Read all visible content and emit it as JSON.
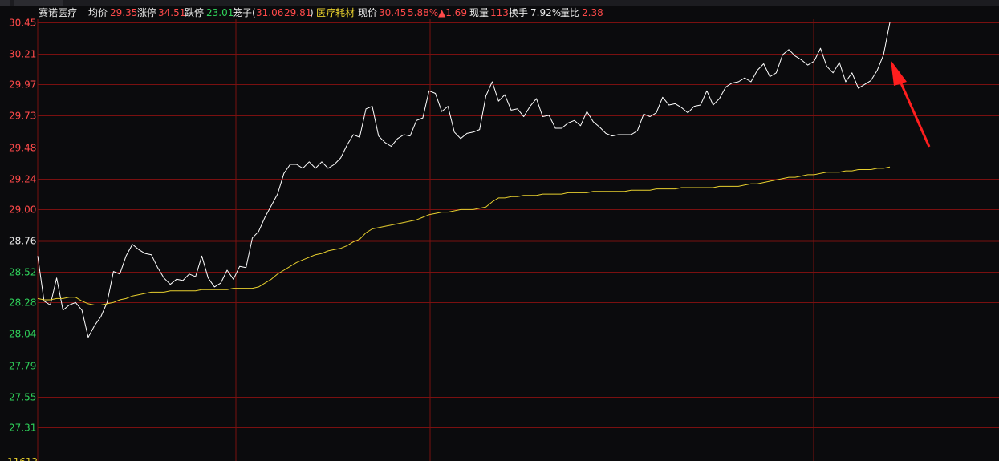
{
  "header": {
    "stock_name": "赛诺医疗",
    "avg_label": "均价",
    "avg_value": "29.35",
    "limit_up_label": "涨停",
    "limit_up_value": "34.51",
    "limit_down_label": "跌停",
    "limit_down_value": "23.01",
    "cage_label": "笼子(",
    "cage_value_1": "31.06",
    "cage_value_2": "29.81",
    "cage_close": ")",
    "sector": "医疗耗材",
    "price_label": "现价",
    "price_value": "30.45",
    "pct_change": "5.88%",
    "change": "▲1.69",
    "volume_label": "现量",
    "volume_value": "113",
    "turnover_label": "换手",
    "turnover_value": "7.92%",
    "vol_ratio_label": "量比",
    "vol_ratio_value": "2.38"
  },
  "colors": {
    "up": "#ff4a4a",
    "down": "#2fd15a",
    "grid": "#7a1010",
    "price_line": "#ffffff",
    "avg_line": "#e7cf2e",
    "arrow": "#ff1e1e",
    "background": "#0b0b0d"
  },
  "chart_data": {
    "type": "line",
    "title": "",
    "xlabel": "",
    "ylabel": "",
    "ylim": [
      27.07,
      30.45
    ],
    "prev_close": 28.76,
    "grid": true,
    "y_ticks": [
      "30.45",
      "30.21",
      "29.97",
      "29.73",
      "29.48",
      "29.24",
      "29.00",
      "28.76",
      "28.52",
      "28.28",
      "28.04",
      "27.79",
      "27.55",
      "27.31"
    ],
    "y_tick_partial": "11612",
    "series": [
      {
        "key": "price",
        "color": "#ffffff",
        "values": [
          28.64,
          28.29,
          28.26,
          28.47,
          28.22,
          28.26,
          28.28,
          28.22,
          28.01,
          28.1,
          28.17,
          28.28,
          28.52,
          28.5,
          28.64,
          28.73,
          28.69,
          28.66,
          28.65,
          28.55,
          28.47,
          28.42,
          28.46,
          28.45,
          28.5,
          28.48,
          28.64,
          28.47,
          28.4,
          28.43,
          28.53,
          28.46,
          28.56,
          28.55,
          28.78,
          28.83,
          28.94,
          29.03,
          29.12,
          29.28,
          29.35,
          29.35,
          29.32,
          29.37,
          29.32,
          29.37,
          29.32,
          29.35,
          29.4,
          29.5,
          29.58,
          29.56,
          29.78,
          29.8,
          29.57,
          29.52,
          29.49,
          29.55,
          29.58,
          29.57,
          29.69,
          29.71,
          29.92,
          29.9,
          29.76,
          29.8,
          29.6,
          29.55,
          29.59,
          29.6,
          29.62,
          29.88,
          29.99,
          29.84,
          29.89,
          29.77,
          29.78,
          29.72,
          29.8,
          29.86,
          29.72,
          29.73,
          29.63,
          29.63,
          29.67,
          29.69,
          29.65,
          29.76,
          29.68,
          29.64,
          29.59,
          29.57,
          29.58,
          29.58,
          29.58,
          29.61,
          29.74,
          29.72,
          29.75,
          29.87,
          29.81,
          29.82,
          29.79,
          29.75,
          29.8,
          29.81,
          29.92,
          29.81,
          29.86,
          29.95,
          29.98,
          29.99,
          30.02,
          29.99,
          30.08,
          30.13,
          30.03,
          30.06,
          30.2,
          30.24,
          30.19,
          30.16,
          30.12,
          30.15,
          30.25,
          30.11,
          30.06,
          30.14,
          29.99,
          30.06,
          29.94,
          29.97,
          30.0,
          30.08,
          30.2,
          30.45
        ]
      },
      {
        "key": "average",
        "color": "#e7cf2e",
        "values": [
          28.31,
          28.3,
          28.3,
          28.31,
          28.31,
          28.32,
          28.32,
          28.29,
          28.27,
          28.26,
          28.26,
          28.27,
          28.28,
          28.3,
          28.31,
          28.33,
          28.34,
          28.35,
          28.36,
          28.36,
          28.36,
          28.37,
          28.37,
          28.37,
          28.37,
          28.37,
          28.38,
          28.38,
          28.38,
          28.38,
          28.38,
          28.39,
          28.39,
          28.39,
          28.39,
          28.4,
          28.43,
          28.46,
          28.5,
          28.53,
          28.56,
          28.59,
          28.61,
          28.63,
          28.65,
          28.66,
          28.68,
          28.69,
          28.7,
          28.72,
          28.75,
          28.77,
          28.82,
          28.85,
          28.86,
          28.87,
          28.88,
          28.89,
          28.9,
          28.91,
          28.92,
          28.94,
          28.96,
          28.97,
          28.98,
          28.98,
          28.99,
          29.0,
          29.0,
          29.0,
          29.01,
          29.02,
          29.06,
          29.09,
          29.09,
          29.1,
          29.1,
          29.11,
          29.11,
          29.11,
          29.12,
          29.12,
          29.12,
          29.12,
          29.13,
          29.13,
          29.13,
          29.13,
          29.14,
          29.14,
          29.14,
          29.14,
          29.14,
          29.14,
          29.15,
          29.15,
          29.15,
          29.15,
          29.16,
          29.16,
          29.16,
          29.16,
          29.17,
          29.17,
          29.17,
          29.17,
          29.17,
          29.17,
          29.18,
          29.18,
          29.18,
          29.18,
          29.19,
          29.2,
          29.2,
          29.21,
          29.22,
          29.23,
          29.24,
          29.25,
          29.25,
          29.26,
          29.27,
          29.27,
          29.28,
          29.29,
          29.29,
          29.29,
          29.3,
          29.3,
          29.31,
          29.31,
          29.31,
          29.32,
          29.32,
          29.33
        ]
      }
    ],
    "annotations": [
      {
        "type": "arrow",
        "color": "#ff1e1e",
        "points_to": "last price"
      }
    ]
  }
}
